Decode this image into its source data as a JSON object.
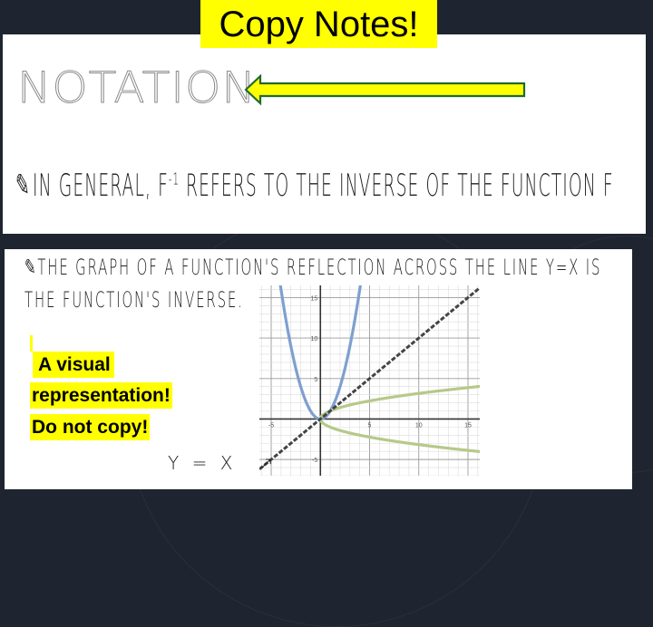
{
  "slide": {
    "title": "Copy Notes!",
    "heading": "NOTATION",
    "general_text_pre": "IN GENERAL, F",
    "general_superscript": "-1",
    "general_text_post": " REFERS TO THE INVERSE OF THE FUNCTION F",
    "reflection_line1": "THE GRAPH OF A FUNCTION'S REFLECTION ACROSS THE LINE Y=X IS",
    "reflection_line2": "THE FUNCTION'S INVERSE.",
    "note_line1": "A visual",
    "note_line2": "representation!",
    "note_line3": "Do not copy!",
    "yx_label": "Y = X",
    "yx_arrow": "↗",
    "pencil_icon": "✎",
    "colors": {
      "highlight": "#ffff00",
      "arrow_fill": "#ffff00",
      "arrow_stroke": "#1e6b30",
      "background": "#1e2530",
      "parabola": "#7ea0cf",
      "sqrt_curves": "#b6c98a",
      "identity_line": "#444444"
    }
  },
  "chart_data": {
    "type": "line",
    "title": "",
    "xlabel": "",
    "ylabel": "",
    "xlim": [
      -6.2,
      16.2
    ],
    "ylim": [
      -7,
      16.5
    ],
    "x_ticks": [
      -5,
      5,
      10,
      15
    ],
    "y_ticks": [
      -5,
      5,
      10,
      15
    ],
    "x_tick_labels": [
      "-5",
      "5",
      "10",
      "15"
    ],
    "y_tick_labels": [
      "-5",
      "5",
      "10",
      "15"
    ],
    "grid": true,
    "series": [
      {
        "name": "y = x^2",
        "expression": "x^2",
        "style": "solid"
      },
      {
        "name": "y = sqrt(x)",
        "expression": "sqrt(x)",
        "style": "solid"
      },
      {
        "name": "y = -sqrt(x)",
        "expression": "-sqrt(x)",
        "style": "solid"
      },
      {
        "name": "y = x",
        "expression": "x",
        "style": "dashed"
      }
    ]
  }
}
